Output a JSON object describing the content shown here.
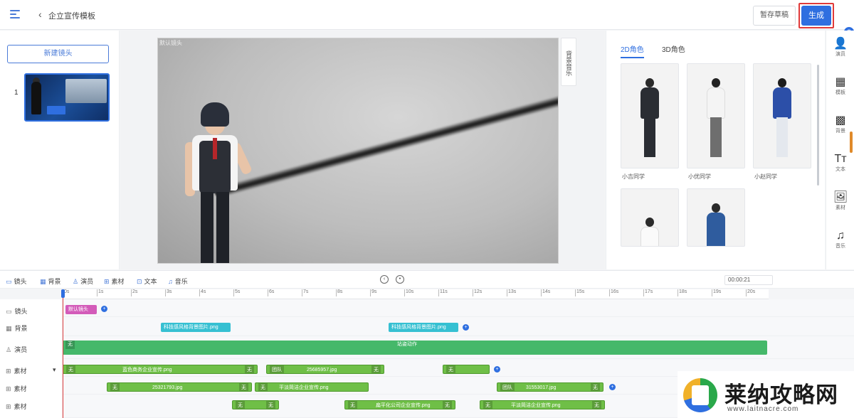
{
  "header": {
    "back_label": "企立宣传模板",
    "save_label": "暂存草稿",
    "generate_label": "生成"
  },
  "left_panel": {
    "new_scene_label": "新建镜头",
    "scenes": [
      {
        "index": "1"
      }
    ]
  },
  "canvas": {
    "stage_label": "默认镜头",
    "bg_music_label": "背景音乐"
  },
  "right_panel": {
    "tabs": [
      "2D角色",
      "3D角色"
    ],
    "characters": [
      {
        "name": "小吉同学"
      },
      {
        "name": "小优同学"
      },
      {
        "name": "小赵同学"
      },
      {
        "name": ""
      },
      {
        "name": ""
      }
    ]
  },
  "tool_rail": [
    {
      "icon": "person-icon",
      "label": "演员"
    },
    {
      "icon": "template-icon",
      "label": "模板"
    },
    {
      "icon": "background-icon",
      "label": "背景"
    },
    {
      "icon": "text-icon",
      "label": "文本"
    },
    {
      "icon": "material-icon",
      "label": "素材"
    },
    {
      "icon": "music-icon",
      "label": "音乐"
    }
  ],
  "timeline": {
    "toolbar": [
      {
        "icon": "camera-icon",
        "label": "镜头"
      },
      {
        "icon": "background-icon",
        "label": "背景"
      },
      {
        "icon": "person-icon",
        "label": "演员"
      },
      {
        "icon": "material-icon",
        "label": "素材"
      },
      {
        "icon": "text-icon",
        "label": "文本"
      },
      {
        "icon": "music-icon",
        "label": "音乐"
      }
    ],
    "time_display": "00:00:21",
    "ruler_ticks": [
      "0s",
      "1s",
      "2s",
      "3s",
      "4s",
      "5s",
      "6s",
      "7s",
      "8s",
      "9s",
      "10s",
      "11s",
      "12s",
      "13s",
      "14s",
      "15s",
      "16s",
      "17s",
      "18s",
      "19s",
      "20s"
    ],
    "tracks": [
      {
        "label": "镜头"
      },
      {
        "label": "背景"
      },
      {
        "label": "演员"
      },
      {
        "label": "素材"
      },
      {
        "label": "素材"
      },
      {
        "label": "素材"
      }
    ],
    "clips": {
      "camera": "默认镜头",
      "bg1": "科技感风格背景图片.png",
      "bg2": "科技感风格背景图片.png",
      "actor_tag": "无",
      "actor_main": "站姿动作",
      "m1_a": "无",
      "m1_b": "蓝色商务企业宣传.png",
      "m1_c": "无",
      "m1_d": "团队",
      "m1_e": "25685957.jpg",
      "m1_f": "无",
      "m1_g": "无",
      "m2_a": "无",
      "m2_b": "25321793.jpg",
      "m2_c": "无",
      "m2_d": "无",
      "m2_e": "平淡简洁企业宣传.png",
      "m2_f": "团队",
      "m2_g": "31553017.jpg",
      "m2_h": "无",
      "m3_a": "无",
      "m3_b": "无",
      "m3_c": "无",
      "m3_d": "扁平化公司企业宣传.png",
      "m3_e": "无",
      "m3_f": "无",
      "m3_g": "平淡简洁企业宣传.png",
      "m3_h": "无"
    }
  },
  "watermark": {
    "title": "莱纳攻略网",
    "url": "www.laitnacre.com"
  },
  "colors": {
    "accent": "#2f6fe0",
    "highlight_border": "#e03a3a",
    "clip_pink": "#d35bb9",
    "clip_cyan": "#36c0d2",
    "clip_green": "#45b86a"
  }
}
